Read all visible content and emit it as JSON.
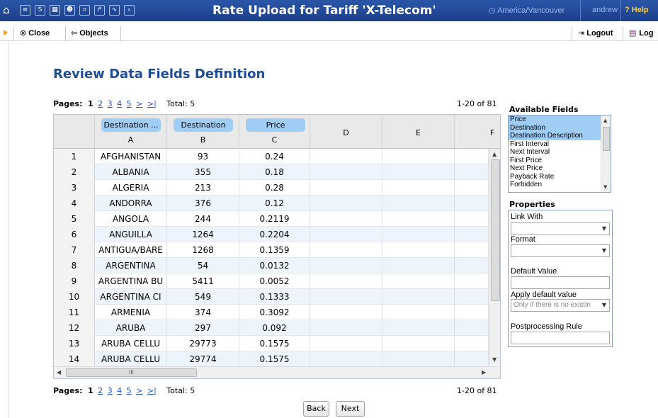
{
  "topbar": {
    "title": "Rate Upload for Tariff 'X-Telecom'",
    "timezone": "America/Vancouver",
    "user": "andrew",
    "help": "Help",
    "icons": [
      "home-icon",
      "list-icon",
      "s-icon",
      "grid-icon",
      "user-icon",
      "group-icon",
      "route-icon",
      "chart-icon",
      "search-icon"
    ]
  },
  "toolbar": {
    "close": "Close",
    "objects": "Objects",
    "logout": "Logout",
    "log": "Log"
  },
  "page_title": "Review Data Fields Definition",
  "pager": {
    "label": "Pages:",
    "current": "1",
    "pages": [
      "2",
      "3",
      "4",
      "5"
    ],
    "next": ">",
    "last": ">|",
    "total": "Total: 5",
    "range": "1-20 of 81"
  },
  "grid": {
    "columns": [
      {
        "field": "Destination ...",
        "letter": "A"
      },
      {
        "field": "Destination",
        "letter": "B"
      },
      {
        "field": "Price",
        "letter": "C"
      },
      {
        "field": "",
        "letter": "D"
      },
      {
        "field": "",
        "letter": "E"
      },
      {
        "field": "",
        "letter": "F"
      }
    ],
    "rows": [
      {
        "n": "1",
        "a": "AFGHANISTAN",
        "b": "93",
        "c": "0.24"
      },
      {
        "n": "2",
        "a": "ALBANIA",
        "b": "355",
        "c": "0.18"
      },
      {
        "n": "3",
        "a": "ALGERIA",
        "b": "213",
        "c": "0.28"
      },
      {
        "n": "4",
        "a": "ANDORRA",
        "b": "376",
        "c": "0.12"
      },
      {
        "n": "5",
        "a": "ANGOLA",
        "b": "244",
        "c": "0.2119"
      },
      {
        "n": "6",
        "a": "ANGUILLA",
        "b": "1264",
        "c": "0.2204"
      },
      {
        "n": "7",
        "a": "ANTIGUA/BARE",
        "b": "1268",
        "c": "0.1359"
      },
      {
        "n": "8",
        "a": "ARGENTINA",
        "b": "54",
        "c": "0.0132"
      },
      {
        "n": "9",
        "a": "ARGENTINA BU",
        "b": "5411",
        "c": "0.0052"
      },
      {
        "n": "10",
        "a": "ARGENTINA CI",
        "b": "549",
        "c": "0.1333"
      },
      {
        "n": "11",
        "a": "ARMENIA",
        "b": "374",
        "c": "0.3092"
      },
      {
        "n": "12",
        "a": "ARUBA",
        "b": "297",
        "c": "0.092"
      },
      {
        "n": "13",
        "a": "ARUBA CELLU",
        "b": "29773",
        "c": "0.1575"
      },
      {
        "n": "14",
        "a": "ARUBA CELLU",
        "b": "29774",
        "c": "0.1575"
      }
    ],
    "hscroll_grip": "III"
  },
  "available_fields": {
    "title": "Available Fields",
    "items": [
      {
        "label": "Price",
        "selected": true
      },
      {
        "label": "Destination",
        "selected": true
      },
      {
        "label": "Destination Description",
        "selected": true
      },
      {
        "label": "First Interval",
        "selected": false
      },
      {
        "label": "Next Interval",
        "selected": false
      },
      {
        "label": "First Price",
        "selected": false
      },
      {
        "label": "Next Price",
        "selected": false
      },
      {
        "label": "Payback Rate",
        "selected": false
      },
      {
        "label": "Forbidden",
        "selected": false
      }
    ]
  },
  "properties": {
    "title": "Properties",
    "link_with": "Link With",
    "format": "Format",
    "default_value": "Default Value",
    "apply_default": "Apply default value",
    "apply_default_selected": "Only if there is no existin",
    "postprocessing": "Postprocessing Rule"
  },
  "buttons": {
    "back": "Back",
    "next": "Next"
  },
  "colors": {
    "topbar": "#1b3f8a",
    "title": "#1f4e97",
    "selected": "#9fcdf4",
    "link": "#1f4fc3"
  }
}
